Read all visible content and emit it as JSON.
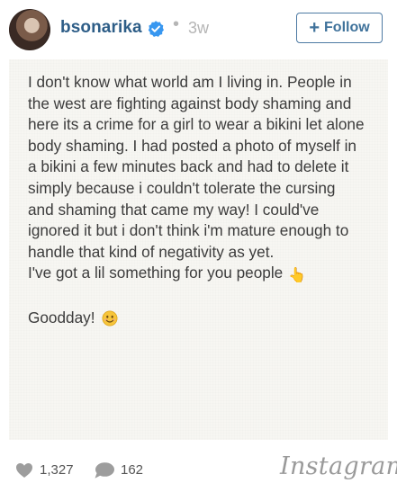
{
  "post": {
    "username": "bsonarika",
    "separator": "•",
    "time_ago": "3w",
    "follow_label": "Follow",
    "follow_icon": "plus-icon",
    "verified_icon": "verified-badge-icon",
    "verified_color": "#3897f0"
  },
  "note": {
    "text": "I don't know what world am I living in. People in\nthe west are fighting against body shaming and\nhere its a crime for a girl to wear a bikini let alone\nbody shaming. I had posted a photo of myself in\na bikini a few minutes back and had to delete it\nsimply because i couldn't tolerate the cursing\nand shaming that came my way! I could've\nignored it but i don't think i'm mature enough to\nhandle that kind of negativity as yet.\nI've got a lil something for you people",
    "finger_emoji": "👆",
    "closing": "Goodday!",
    "smile_icon": "smiling-face-icon"
  },
  "footer": {
    "likes": "1,327",
    "comments": "162",
    "brand": "Instagram",
    "colors": {
      "link": "#3f729b",
      "muted": "#b5b5b5"
    }
  }
}
